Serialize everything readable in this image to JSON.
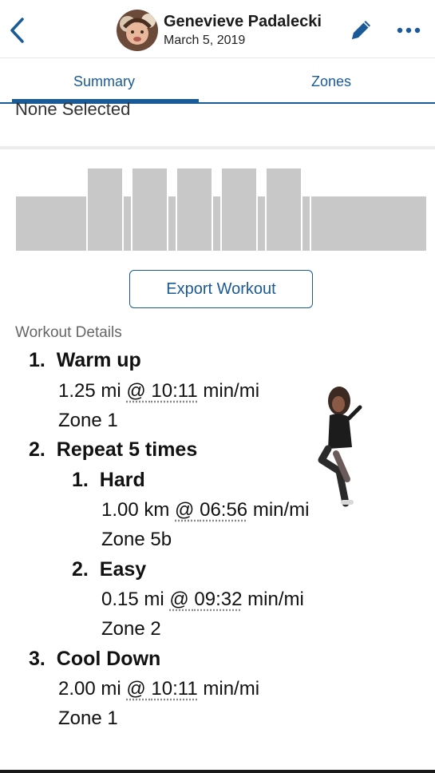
{
  "header": {
    "user_name": "Genevieve Padalecki",
    "date": "March 5, 2019",
    "back_icon": "chevron-left-icon",
    "edit_icon": "pencil-icon",
    "more_icon": "more-dots-icon"
  },
  "tabs": [
    {
      "label": "Summary",
      "active": true
    },
    {
      "label": "Zones",
      "active": false
    }
  ],
  "selection_text": "None Selected",
  "export_button": "Export Workout",
  "section_label": "Workout Details",
  "workout": {
    "steps": [
      {
        "number": "1.",
        "title": "Warm up",
        "distance": "1.25 mi",
        "at": "@",
        "pace": "10:11",
        "unit": "min/mi",
        "zone": "Zone 1"
      },
      {
        "number": "2.",
        "title": "Repeat 5 times",
        "substeps": [
          {
            "number": "1.",
            "title": "Hard",
            "distance": "1.00 km",
            "at": "@",
            "pace": "06:56",
            "unit": "min/mi",
            "zone": "Zone 5b"
          },
          {
            "number": "2.",
            "title": "Easy",
            "distance": "0.15 mi",
            "at": "@",
            "pace": "09:32",
            "unit": "min/mi",
            "zone": "Zone 2"
          }
        ]
      },
      {
        "number": "3.",
        "title": "Cool Down",
        "distance": "2.00 mi",
        "at": "@",
        "pace": "10:11",
        "unit": "min/mi",
        "zone": "Zone 1"
      }
    ]
  },
  "chart_data": {
    "type": "bar",
    "bar_color": "#c8c8c8",
    "segments": [
      {
        "label": "Warm up",
        "level": 0.6
      },
      {
        "label": "Hard",
        "level": 0.9
      },
      {
        "label": "Easy",
        "level": 0.6
      },
      {
        "label": "Hard",
        "level": 0.9
      },
      {
        "label": "Easy",
        "level": 0.6
      },
      {
        "label": "Hard",
        "level": 0.9
      },
      {
        "label": "Easy",
        "level": 0.6
      },
      {
        "label": "Hard",
        "level": 0.9
      },
      {
        "label": "Easy",
        "level": 0.6
      },
      {
        "label": "Hard",
        "level": 0.9
      },
      {
        "label": "Easy",
        "level": 0.6
      },
      {
        "label": "Cool Down",
        "level": 0.6
      }
    ]
  },
  "colors": {
    "accent": "#1a5a96",
    "bar": "#c8c8c8"
  }
}
